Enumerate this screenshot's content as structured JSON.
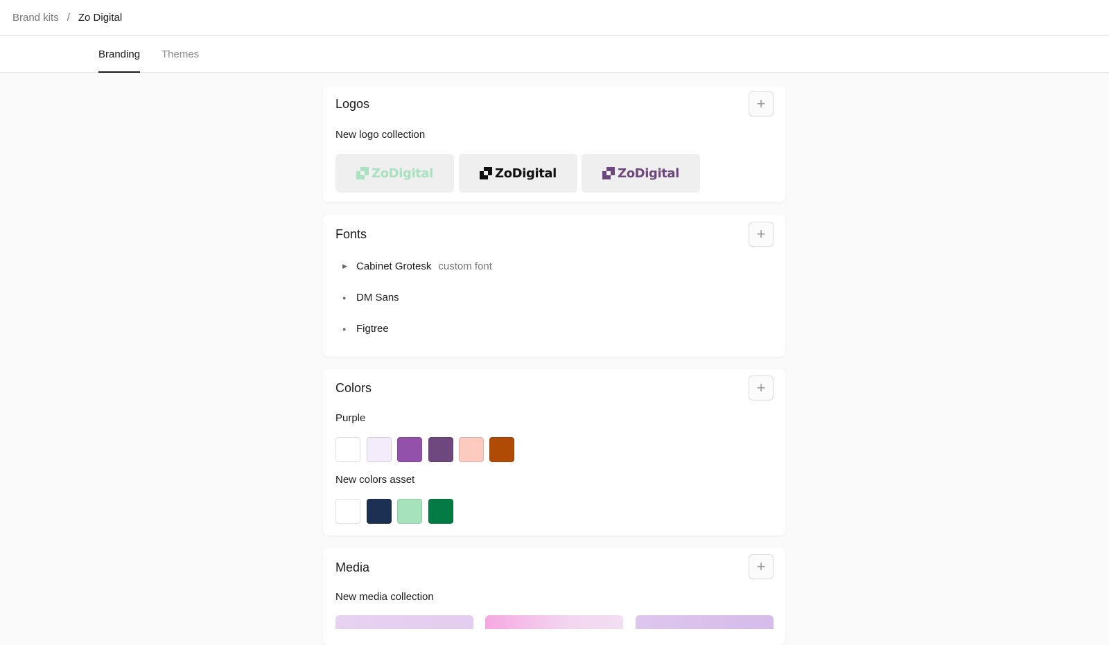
{
  "breadcrumb": {
    "parent": "Brand kits",
    "separator": "/",
    "current": "Zo Digital"
  },
  "tabs": [
    {
      "label": "Branding",
      "active": true
    },
    {
      "label": "Themes",
      "active": false
    }
  ],
  "logos": {
    "title": "Logos",
    "add_label": "+",
    "collection_name": "New logo collection",
    "items": [
      {
        "text": "ZoDigital",
        "color": "#a8e2bf",
        "icon": "zo-mark-icon"
      },
      {
        "text": "ZoDigital",
        "color": "#111111",
        "icon": "zo-mark-icon"
      },
      {
        "text": "ZoDigital",
        "color": "#6d477e",
        "icon": "zo-mark-icon"
      }
    ]
  },
  "fonts": {
    "title": "Fonts",
    "add_label": "+",
    "items": [
      {
        "name": "Cabinet Grotesk",
        "tag": "custom font",
        "marker": "triangle-right-icon"
      },
      {
        "name": "DM Sans",
        "tag": "",
        "marker": "bullet-icon"
      },
      {
        "name": "Figtree",
        "tag": "",
        "marker": "bullet-icon"
      }
    ]
  },
  "colors": {
    "title": "Colors",
    "add_label": "+",
    "groups": [
      {
        "name": "Purple",
        "swatches": [
          "#ffffff",
          "#f4ecfb",
          "#9451ac",
          "#6d477e",
          "#fdcbbf",
          "#b04b06"
        ]
      },
      {
        "name": "New colors asset",
        "swatches": [
          "#ffffff",
          "#1b3052",
          "#a6e3bd",
          "#047b45"
        ]
      }
    ]
  },
  "media": {
    "title": "Media",
    "add_label": "+",
    "collection_name": "New media collection",
    "tiles": [
      {
        "background": "linear-gradient(90deg,#e7d2f2,#e3cdf0)"
      },
      {
        "background": "linear-gradient(90deg,#f6a8e1,#f3d6f0 60%,#f2def3)"
      },
      {
        "background": "linear-gradient(90deg,#ddc6ee,#d5bce9)"
      }
    ]
  }
}
